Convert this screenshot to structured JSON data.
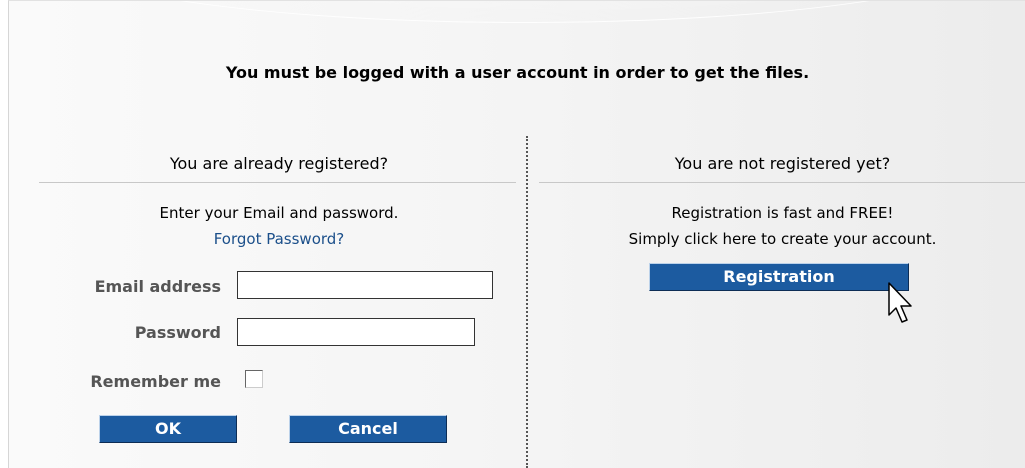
{
  "notice": "You must be logged with a user account in order to get the files.",
  "login": {
    "title": "You are already registered?",
    "instruction": "Enter your Email and password.",
    "forgot_password_link": "Forgot Password?",
    "email_label": "Email address",
    "email_value": "",
    "password_label": "Password",
    "password_value": "",
    "remember_label": "Remember me",
    "remember_checked": false,
    "ok_label": "OK",
    "cancel_label": "Cancel"
  },
  "register": {
    "title": "You are not registered yet?",
    "line1": "Registration is fast and FREE!",
    "line2": "Simply click here to create your account.",
    "button_label": "Registration"
  },
  "colors": {
    "button_blue": "#1c5ba0",
    "link_blue": "#1b4f8a",
    "label_gray": "#555555"
  },
  "icons": {
    "cursor": "mouse-pointer-icon"
  }
}
